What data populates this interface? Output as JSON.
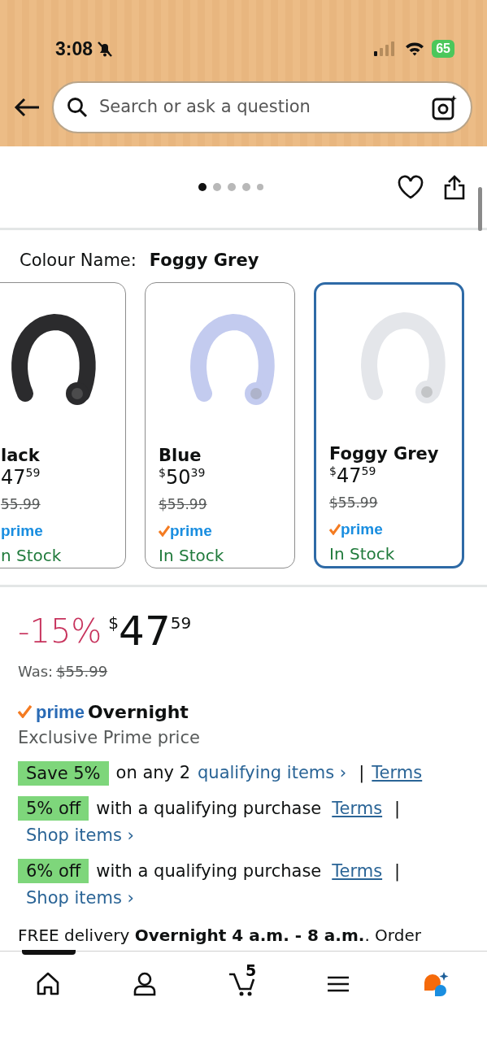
{
  "status_bar": {
    "time": "3:08",
    "battery": "65"
  },
  "search": {
    "placeholder": "Search or ask a question"
  },
  "carousel": {
    "dots": [
      {
        "selected": true
      },
      {
        "selected": false
      },
      {
        "selected": false
      },
      {
        "selected": false
      },
      {
        "selected": false
      }
    ]
  },
  "colour": {
    "label": "Colour Name:",
    "value": "Foggy Grey"
  },
  "variants": [
    {
      "name": "lack",
      "price_whole": "47",
      "price_fraction": "59",
      "was": "55.99",
      "prime_check": false,
      "prime": "prime",
      "stock": "n Stock",
      "color": "#2b2b2d",
      "selected": false
    },
    {
      "name": "Blue",
      "currency": "$",
      "price_whole": "50",
      "price_fraction": "39",
      "was": "$55.99",
      "prime_check": true,
      "prime": "prime",
      "stock": "In Stock",
      "color": "#c3cbef",
      "selected": false
    },
    {
      "name": "Foggy Grey",
      "currency": "$",
      "price_whole": "47",
      "price_fraction": "59",
      "was": "$55.99",
      "prime_check": true,
      "prime": "prime",
      "stock": "In Stock",
      "color": "#e4e6ea",
      "selected": true
    }
  ],
  "price": {
    "discount": "-15%",
    "currency": "$",
    "whole": "47",
    "fraction": "59",
    "was_label": "Was:",
    "was": "$55.99"
  },
  "prime": {
    "logo": "prime",
    "label": "Overnight",
    "note": "Exclusive Prime price"
  },
  "offers": [
    {
      "badge": "Save 5%",
      "text": "on any 2",
      "parts": [
        {
          "kind": "link",
          "text": "qualifying items ›"
        },
        {
          "kind": "sep",
          "text": "|"
        },
        {
          "kind": "terms",
          "text": "Terms"
        }
      ]
    },
    {
      "badge": "5% off",
      "text": "with a qualifying purchase",
      "parts": [
        {
          "kind": "terms",
          "text": "Terms"
        },
        {
          "kind": "sep",
          "text": "|"
        },
        {
          "kind": "link",
          "text": "Shop items ›"
        }
      ]
    },
    {
      "badge": "6% off",
      "text": "with a qualifying purchase",
      "parts": [
        {
          "kind": "terms",
          "text": "Terms"
        },
        {
          "kind": "sep",
          "text": "|"
        },
        {
          "kind": "link",
          "text": "Shop items ›"
        }
      ]
    }
  ],
  "delivery": "FREE delivery **Overnight 4 a.m. - 8 a.m.**. Order",
  "bottom_nav": [
    {
      "kind": "home",
      "selected": true
    },
    {
      "kind": "account",
      "selected": false
    },
    {
      "kind": "cart",
      "count": "5",
      "selected": false
    },
    {
      "kind": "menu",
      "selected": false
    },
    {
      "kind": "assistant",
      "selected": false
    }
  ]
}
